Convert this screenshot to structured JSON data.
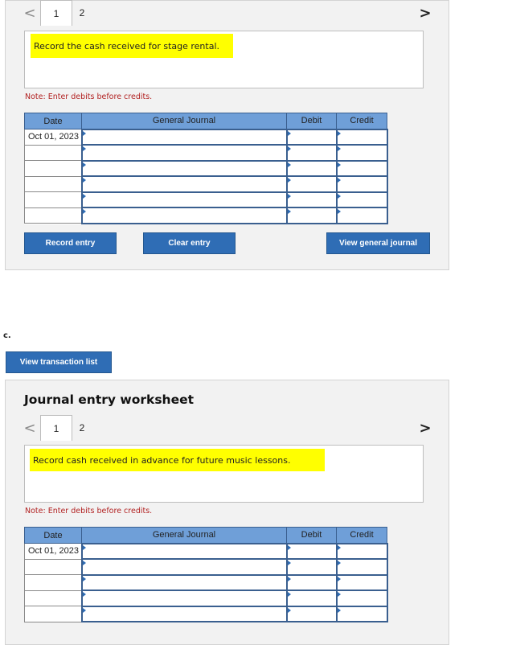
{
  "worksheet_top": {
    "tabs": [
      {
        "label": "1"
      },
      {
        "label": "2"
      }
    ],
    "prev_arrow": "<",
    "next_arrow": ">",
    "description": "Record the cash received for stage rental.",
    "note": "Note: Enter debits before credits.",
    "columns": {
      "date": "Date",
      "journal": "General Journal",
      "debit": "Debit",
      "credit": "Credit"
    },
    "first_date": "Oct 01, 2023",
    "buttons": {
      "record": "Record entry",
      "clear": "Clear entry",
      "view_journal": "View general journal"
    }
  },
  "section_c": {
    "label": "c.",
    "view_transaction_list": "View transaction list"
  },
  "worksheet_bottom": {
    "heading": "Journal entry worksheet",
    "tabs": [
      {
        "label": "1"
      },
      {
        "label": "2"
      }
    ],
    "prev_arrow": "<",
    "next_arrow": ">",
    "description": "Record cash received in advance for future music lessons.",
    "note": "Note: Enter debits before credits.",
    "columns": {
      "date": "Date",
      "journal": "General Journal",
      "debit": "Debit",
      "credit": "Credit"
    },
    "first_date": "Oct 01, 2023"
  }
}
